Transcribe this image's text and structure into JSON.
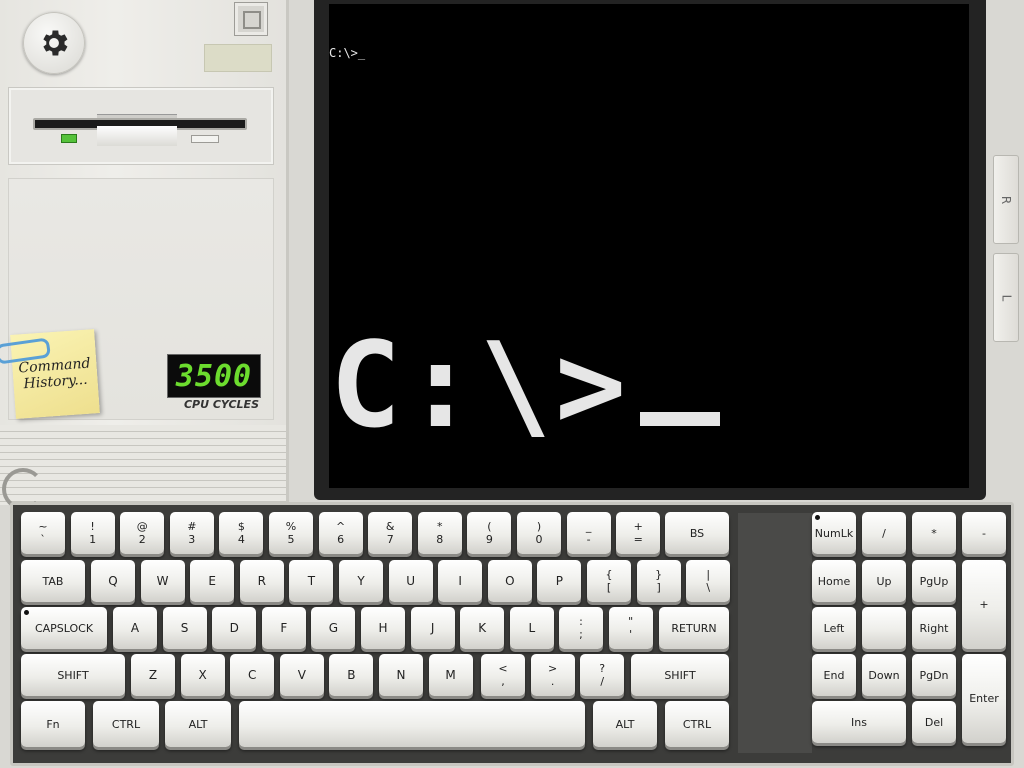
{
  "case": {
    "brand_plate": "",
    "sticky_note": "Command History...",
    "cpu_cycles_value": "3500",
    "cpu_cycles_label": "CPU CYCLES"
  },
  "monitor": {
    "prompt_small": "C:\\>_",
    "prompt_big": "C:\\>",
    "side_buttons": {
      "right": "R",
      "left": "L"
    }
  },
  "keyboard": {
    "number_row": [
      {
        "top": "~",
        "bottom": "`"
      },
      {
        "top": "!",
        "bottom": "1"
      },
      {
        "top": "@",
        "bottom": "2"
      },
      {
        "top": "#",
        "bottom": "3"
      },
      {
        "top": "$",
        "bottom": "4"
      },
      {
        "top": "%",
        "bottom": "5"
      },
      {
        "top": "^",
        "bottom": "6"
      },
      {
        "top": "&",
        "bottom": "7"
      },
      {
        "top": "*",
        "bottom": "8"
      },
      {
        "top": "(",
        "bottom": "9"
      },
      {
        "top": ")",
        "bottom": "0"
      },
      {
        "top": "_",
        "bottom": "-"
      },
      {
        "top": "+",
        "bottom": "="
      }
    ],
    "bs": "BS",
    "tab": "TAB",
    "qwerty": [
      "Q",
      "W",
      "E",
      "R",
      "T",
      "Y",
      "U",
      "I",
      "O",
      "P"
    ],
    "bracket_keys": [
      {
        "top": "{",
        "bottom": "["
      },
      {
        "top": "}",
        "bottom": "]"
      },
      {
        "top": "|",
        "bottom": "\\"
      }
    ],
    "capslock": "CAPSLOCK",
    "asdf": [
      "A",
      "S",
      "D",
      "F",
      "G",
      "H",
      "J",
      "K",
      "L"
    ],
    "semicolon_keys": [
      {
        "top": ":",
        "bottom": ";"
      },
      {
        "top": "\"",
        "bottom": "'"
      }
    ],
    "return": "RETURN",
    "shift": "SHIFT",
    "zxcv": [
      "Z",
      "X",
      "C",
      "V",
      "B",
      "N",
      "M"
    ],
    "punct_keys": [
      {
        "top": "<",
        "bottom": ","
      },
      {
        "top": ">",
        "bottom": "."
      },
      {
        "top": "?",
        "bottom": "/"
      }
    ],
    "fn": "Fn",
    "ctrl": "CTRL",
    "alt": "ALT",
    "space": ""
  },
  "numpad": {
    "numlk": "NumLk",
    "slash": "/",
    "star": "*",
    "minus": "-",
    "home": "Home",
    "up": "Up",
    "pgup": "PgUp",
    "plus": "+",
    "left": "Left",
    "center": "",
    "right": "Right",
    "end": "End",
    "down": "Down",
    "pgdn": "PgDn",
    "enter": "Enter",
    "ins": "Ins",
    "del": "Del"
  }
}
